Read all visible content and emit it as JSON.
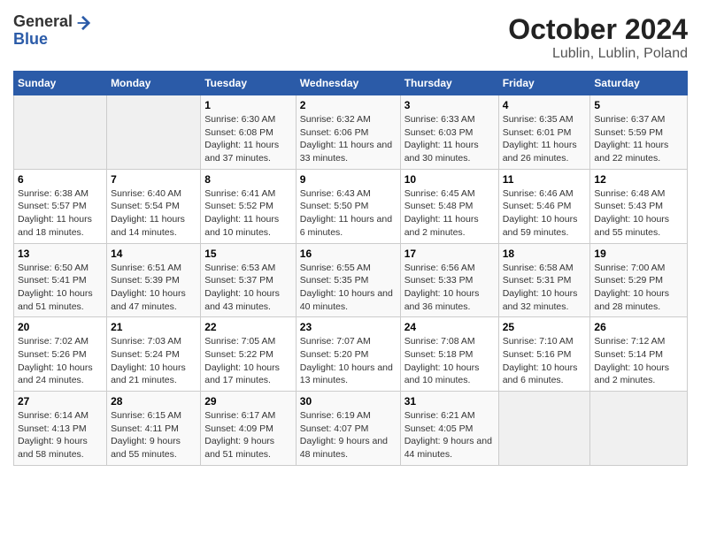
{
  "header": {
    "logo_general": "General",
    "logo_blue": "Blue",
    "title": "October 2024",
    "subtitle": "Lublin, Lublin, Poland"
  },
  "days_of_week": [
    "Sunday",
    "Monday",
    "Tuesday",
    "Wednesday",
    "Thursday",
    "Friday",
    "Saturday"
  ],
  "weeks": [
    {
      "cells": [
        {
          "empty": true
        },
        {
          "empty": true
        },
        {
          "day": "1",
          "sunrise": "6:30 AM",
          "sunset": "6:08 PM",
          "daylight": "11 hours and 37 minutes."
        },
        {
          "day": "2",
          "sunrise": "6:32 AM",
          "sunset": "6:06 PM",
          "daylight": "11 hours and 33 minutes."
        },
        {
          "day": "3",
          "sunrise": "6:33 AM",
          "sunset": "6:03 PM",
          "daylight": "11 hours and 30 minutes."
        },
        {
          "day": "4",
          "sunrise": "6:35 AM",
          "sunset": "6:01 PM",
          "daylight": "11 hours and 26 minutes."
        },
        {
          "day": "5",
          "sunrise": "6:37 AM",
          "sunset": "5:59 PM",
          "daylight": "11 hours and 22 minutes."
        }
      ]
    },
    {
      "cells": [
        {
          "day": "6",
          "sunrise": "6:38 AM",
          "sunset": "5:57 PM",
          "daylight": "11 hours and 18 minutes."
        },
        {
          "day": "7",
          "sunrise": "6:40 AM",
          "sunset": "5:54 PM",
          "daylight": "11 hours and 14 minutes."
        },
        {
          "day": "8",
          "sunrise": "6:41 AM",
          "sunset": "5:52 PM",
          "daylight": "11 hours and 10 minutes."
        },
        {
          "day": "9",
          "sunrise": "6:43 AM",
          "sunset": "5:50 PM",
          "daylight": "11 hours and 6 minutes."
        },
        {
          "day": "10",
          "sunrise": "6:45 AM",
          "sunset": "5:48 PM",
          "daylight": "11 hours and 2 minutes."
        },
        {
          "day": "11",
          "sunrise": "6:46 AM",
          "sunset": "5:46 PM",
          "daylight": "10 hours and 59 minutes."
        },
        {
          "day": "12",
          "sunrise": "6:48 AM",
          "sunset": "5:43 PM",
          "daylight": "10 hours and 55 minutes."
        }
      ]
    },
    {
      "cells": [
        {
          "day": "13",
          "sunrise": "6:50 AM",
          "sunset": "5:41 PM",
          "daylight": "10 hours and 51 minutes."
        },
        {
          "day": "14",
          "sunrise": "6:51 AM",
          "sunset": "5:39 PM",
          "daylight": "10 hours and 47 minutes."
        },
        {
          "day": "15",
          "sunrise": "6:53 AM",
          "sunset": "5:37 PM",
          "daylight": "10 hours and 43 minutes."
        },
        {
          "day": "16",
          "sunrise": "6:55 AM",
          "sunset": "5:35 PM",
          "daylight": "10 hours and 40 minutes."
        },
        {
          "day": "17",
          "sunrise": "6:56 AM",
          "sunset": "5:33 PM",
          "daylight": "10 hours and 36 minutes."
        },
        {
          "day": "18",
          "sunrise": "6:58 AM",
          "sunset": "5:31 PM",
          "daylight": "10 hours and 32 minutes."
        },
        {
          "day": "19",
          "sunrise": "7:00 AM",
          "sunset": "5:29 PM",
          "daylight": "10 hours and 28 minutes."
        }
      ]
    },
    {
      "cells": [
        {
          "day": "20",
          "sunrise": "7:02 AM",
          "sunset": "5:26 PM",
          "daylight": "10 hours and 24 minutes."
        },
        {
          "day": "21",
          "sunrise": "7:03 AM",
          "sunset": "5:24 PM",
          "daylight": "10 hours and 21 minutes."
        },
        {
          "day": "22",
          "sunrise": "7:05 AM",
          "sunset": "5:22 PM",
          "daylight": "10 hours and 17 minutes."
        },
        {
          "day": "23",
          "sunrise": "7:07 AM",
          "sunset": "5:20 PM",
          "daylight": "10 hours and 13 minutes."
        },
        {
          "day": "24",
          "sunrise": "7:08 AM",
          "sunset": "5:18 PM",
          "daylight": "10 hours and 10 minutes."
        },
        {
          "day": "25",
          "sunrise": "7:10 AM",
          "sunset": "5:16 PM",
          "daylight": "10 hours and 6 minutes."
        },
        {
          "day": "26",
          "sunrise": "7:12 AM",
          "sunset": "5:14 PM",
          "daylight": "10 hours and 2 minutes."
        }
      ]
    },
    {
      "cells": [
        {
          "day": "27",
          "sunrise": "6:14 AM",
          "sunset": "4:13 PM",
          "daylight": "9 hours and 58 minutes."
        },
        {
          "day": "28",
          "sunrise": "6:15 AM",
          "sunset": "4:11 PM",
          "daylight": "9 hours and 55 minutes."
        },
        {
          "day": "29",
          "sunrise": "6:17 AM",
          "sunset": "4:09 PM",
          "daylight": "9 hours and 51 minutes."
        },
        {
          "day": "30",
          "sunrise": "6:19 AM",
          "sunset": "4:07 PM",
          "daylight": "9 hours and 48 minutes."
        },
        {
          "day": "31",
          "sunrise": "6:21 AM",
          "sunset": "4:05 PM",
          "daylight": "9 hours and 44 minutes."
        },
        {
          "empty": true
        },
        {
          "empty": true
        }
      ]
    }
  ]
}
